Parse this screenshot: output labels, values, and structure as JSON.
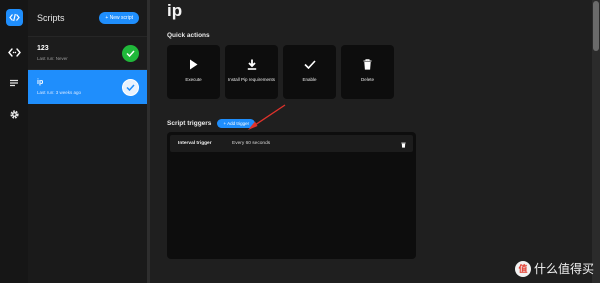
{
  "sidebar": {
    "title": "Scripts",
    "new_script_label": "+ New script",
    "items": [
      {
        "name": "123",
        "last_run": "Last run: Never",
        "status": "success"
      },
      {
        "name": "ip",
        "last_run": "Last run: 3 weeks ago",
        "status": "selected"
      }
    ]
  },
  "main": {
    "title": "ip",
    "quick_actions_label": "Quick actions",
    "actions": [
      {
        "label": "Execute",
        "icon": "play-icon"
      },
      {
        "label": "Install Pip requirements",
        "icon": "download-icon"
      },
      {
        "label": "Enable",
        "icon": "check-icon"
      },
      {
        "label": "Delete",
        "icon": "trash-icon"
      }
    ],
    "triggers_label": "Script triggers",
    "add_trigger_label": "+ Add trigger",
    "triggers": [
      {
        "type": "Interval trigger",
        "value": "Every 60 seconds"
      }
    ]
  },
  "watermark": {
    "badge": "值",
    "text": "什么值得买"
  },
  "colors": {
    "accent": "#1f8efc",
    "success": "#20b83a",
    "annotation": "#e0322b",
    "panel": "#0d0d0d"
  }
}
